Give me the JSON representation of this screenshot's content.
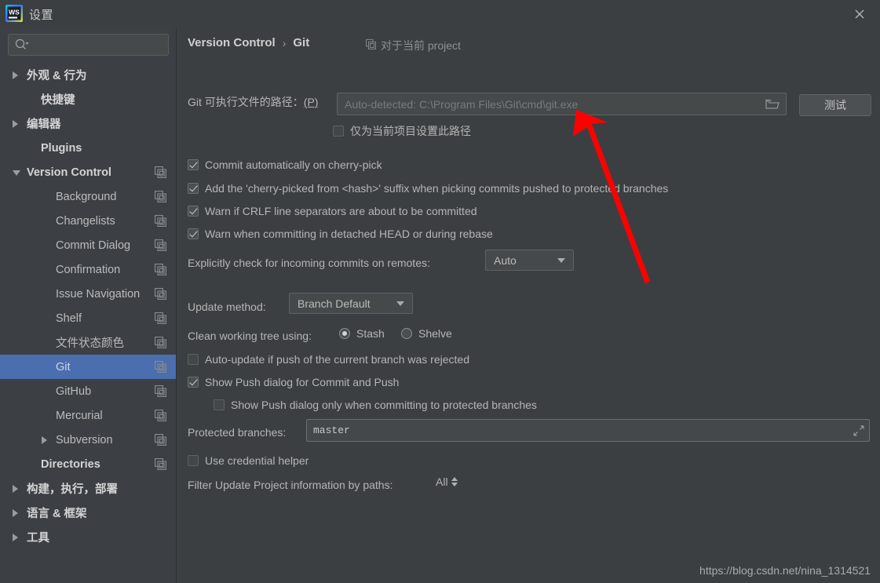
{
  "window": {
    "title": "设置",
    "logo_icon": "webstorm-logo-icon",
    "close_icon": "close-icon"
  },
  "sidebar": {
    "search": {
      "placeholder": "",
      "value": "",
      "icon": "search-icon",
      "dropdown_icon": "chevron-down-icon"
    },
    "items": [
      {
        "label": "外观 & 行为",
        "indent": 0,
        "arrow": "right",
        "bold": true,
        "scope_icon": false,
        "selected": false
      },
      {
        "label": "快捷键",
        "indent": 1,
        "arrow": "none",
        "bold": true,
        "scope_icon": false,
        "selected": false
      },
      {
        "label": "编辑器",
        "indent": 0,
        "arrow": "right",
        "bold": true,
        "scope_icon": false,
        "selected": false
      },
      {
        "label": "Plugins",
        "indent": 1,
        "arrow": "none",
        "bold": true,
        "scope_icon": false,
        "selected": false
      },
      {
        "label": "Version Control",
        "indent": 0,
        "arrow": "down",
        "bold": true,
        "scope_icon": true,
        "selected": false
      },
      {
        "label": "Background",
        "indent": 2,
        "arrow": "none",
        "bold": false,
        "scope_icon": true,
        "selected": false
      },
      {
        "label": "Changelists",
        "indent": 2,
        "arrow": "none",
        "bold": false,
        "scope_icon": true,
        "selected": false
      },
      {
        "label": "Commit Dialog",
        "indent": 2,
        "arrow": "none",
        "bold": false,
        "scope_icon": true,
        "selected": false
      },
      {
        "label": "Confirmation",
        "indent": 2,
        "arrow": "none",
        "bold": false,
        "scope_icon": true,
        "selected": false
      },
      {
        "label": "Issue Navigation",
        "indent": 2,
        "arrow": "none",
        "bold": false,
        "scope_icon": true,
        "selected": false
      },
      {
        "label": "Shelf",
        "indent": 2,
        "arrow": "none",
        "bold": false,
        "scope_icon": true,
        "selected": false
      },
      {
        "label": "文件状态颜色",
        "indent": 2,
        "arrow": "none",
        "bold": false,
        "scope_icon": true,
        "selected": false
      },
      {
        "label": "Git",
        "indent": 2,
        "arrow": "none",
        "bold": false,
        "scope_icon": true,
        "selected": true
      },
      {
        "label": "GitHub",
        "indent": 2,
        "arrow": "none",
        "bold": false,
        "scope_icon": true,
        "selected": false
      },
      {
        "label": "Mercurial",
        "indent": 2,
        "arrow": "none",
        "bold": false,
        "scope_icon": true,
        "selected": false
      },
      {
        "label": "Subversion",
        "indent": 2,
        "arrow": "right",
        "bold": false,
        "scope_icon": true,
        "selected": false
      },
      {
        "label": "Directories",
        "indent": 1,
        "arrow": "none",
        "bold": true,
        "scope_icon": true,
        "selected": false
      },
      {
        "label": "构建，执行，部署",
        "indent": 0,
        "arrow": "right",
        "bold": true,
        "scope_icon": false,
        "selected": false
      },
      {
        "label": "语言 & 框架",
        "indent": 0,
        "arrow": "right",
        "bold": true,
        "scope_icon": false,
        "selected": false
      },
      {
        "label": "工具",
        "indent": 0,
        "arrow": "right",
        "bold": true,
        "scope_icon": false,
        "selected": false
      }
    ]
  },
  "main": {
    "breadcrumb": {
      "parent": "Version Control",
      "separator": "›",
      "current": "Git"
    },
    "scope_hint": {
      "icon": "scope-icon",
      "text": "对于当前 project"
    },
    "path": {
      "label": "Git 可执行文件的路径：",
      "mnemonic": "(P)",
      "value": "",
      "placeholder": "Auto-detected: C:\\Program Files\\Git\\cmd\\git.exe",
      "browse_icon": "folder-icon"
    },
    "test_button": "测试",
    "project_only_checkbox": {
      "label": "仅为当前项目设置此路径",
      "checked": false
    },
    "checkboxes": [
      {
        "label": "Commit automatically on cherry-pick",
        "checked": true
      },
      {
        "label": "Add the 'cherry-picked from <hash>' suffix when picking commits pushed to protected branches",
        "checked": true
      },
      {
        "label": "Warn if CRLF line separators are about to be committed",
        "checked": true
      },
      {
        "label": "Warn when committing in detached HEAD or during rebase",
        "checked": true
      }
    ],
    "incoming_commits": {
      "label": "Explicitly check for incoming commits on remotes:",
      "value": "Auto"
    },
    "update_method": {
      "label": "Update method:",
      "value": "Branch Default"
    },
    "clean_working_tree": {
      "label": "Clean working tree using:",
      "options": [
        {
          "label": "Stash",
          "selected": true
        },
        {
          "label": "Shelve",
          "selected": false
        }
      ]
    },
    "push_checkboxes": [
      {
        "label": "Auto-update if push of the current branch was rejected",
        "checked": false
      },
      {
        "label": "Show Push dialog for Commit and Push",
        "checked": true
      },
      {
        "label": "Show Push dialog only when committing to protected branches",
        "checked": false,
        "nested": true
      }
    ],
    "protected_branches": {
      "label": "Protected branches:",
      "value": "master",
      "expand_icon": "expand-icon"
    },
    "credential_helper": {
      "label": "Use credential helper",
      "checked": false
    },
    "filter_paths": {
      "label": "Filter Update Project information by paths:",
      "value": "All"
    }
  },
  "watermark": "https://blog.csdn.net/nina_1314521",
  "colors": {
    "window_bg": "#3c3f41",
    "sidebar_bg": "#3c4045",
    "selection": "#4b6eaf",
    "field_bg": "#45494a",
    "border": "#5e6264",
    "text": "#bbbbbb",
    "muted_text": "#8d9095",
    "annotation_arrow": "#ff0000"
  }
}
